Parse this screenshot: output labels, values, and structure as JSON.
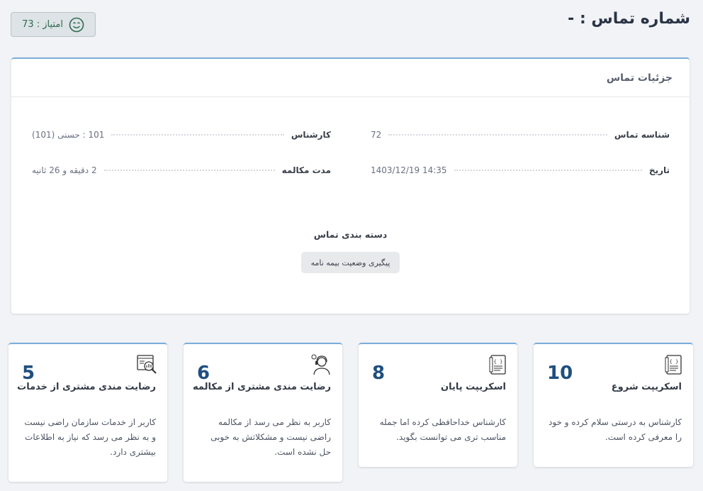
{
  "header": {
    "title": "شماره تماس : -",
    "score_label": "امتیاز : 73",
    "score_icon": "smile-icon",
    "score_color": "#2f6a4f"
  },
  "details": {
    "title": "جزئیات تماس",
    "call_id_label": "شناسه تماس",
    "call_id_value": "72",
    "date_label": "تاریخ",
    "date_value": "1403/12/19  14:35",
    "expert_label": "کارشناس",
    "expert_value": "101 : حسنی (101)",
    "duration_label": "مدت مکالمه",
    "duration_value": "2 دقیقه و 26 ثانیه",
    "category_title": "دسته بندی تماس",
    "category_tag": "پیگیری وضعیت بیمه نامه"
  },
  "metrics": [
    {
      "value": "10",
      "title": "اسکریپت شروع",
      "description": "کارشناس به درستی سلام کرده و خود را معرفی کرده است.",
      "icon": "script-document-icon"
    },
    {
      "value": "8",
      "title": "اسکریپت پایان",
      "description": "کارشناس خداحافظی کرده اما جمله مناسب تری می توانست بگوید.",
      "icon": "script-document-icon"
    },
    {
      "value": "6",
      "title": "رضایت مندی مشتری از مکالمه",
      "description": "کاربر به نظر می رسد از مکالمه راضی نیست و مشکلاتش به خوبی حل نشده است.",
      "icon": "customer-agent-icon"
    },
    {
      "value": "5",
      "title": "رضایت مندی مشتری از خدمات",
      "description": "کاربر از خدمات سازمان راضی نیست و به نظر می رسد که نیاز به اطلاعات بیشتری دارد.",
      "icon": "service-analysis-icon"
    }
  ],
  "colors": {
    "accent": "#7aaedb",
    "metric_value": "#1f4f7f"
  }
}
